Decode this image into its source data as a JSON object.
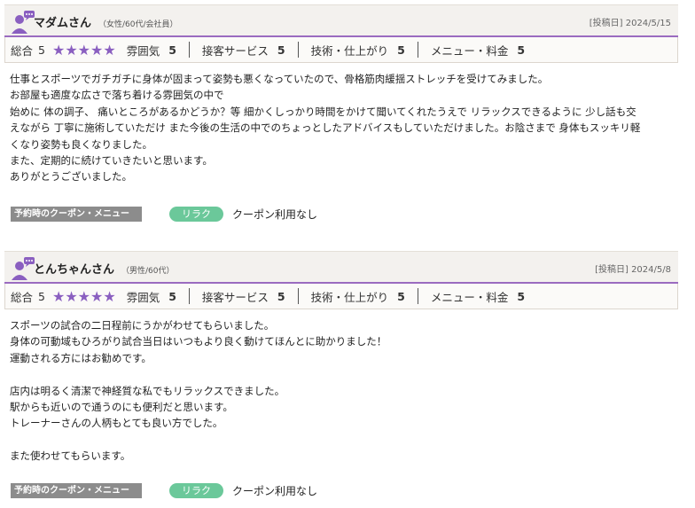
{
  "reviews": [
    {
      "name": "マダムさん",
      "meta": "（女性/60代/会社員）",
      "date": "[投稿日] 2024/5/15",
      "scores": {
        "total_label": "総合",
        "total": "5",
        "stars": "★★★★★",
        "items": [
          {
            "label": "雰囲気",
            "value": "5"
          },
          {
            "label": "接客サービス",
            "value": "5"
          },
          {
            "label": "技術・仕上がり",
            "value": "5"
          },
          {
            "label": "メニュー・料金",
            "value": "5"
          }
        ]
      },
      "body": [
        "仕事とスポーツでガチガチに身体が固まって姿勢も悪くなっていたので、骨格筋肉緩揺ストレッチを受けてみました。",
        "お部屋も適度な広さで落ち着ける雰囲気の中で",
        "始めに 体の調子、 痛いところがあるかどうか？等 細かくしっかり時間をかけて聞いてくれたうえで リラックスできるように 少し話も交",
        "えながら 丁寧に施術していただけ また今後の生活の中でのちょっとしたアドバイスもしていただけました。お陰さまで 身体もスッキリ軽",
        "くなり姿勢も良くなりました。",
        "また、定期的に続けていきたいと思います。",
        "ありがとうございました。"
      ],
      "coupon_label": "予約時のクーポン・メニュー",
      "tag": "リラク",
      "coupon_text": "クーポン利用なし"
    },
    {
      "name": "とんちゃんさん",
      "meta": "（男性/60代）",
      "date": "[投稿日] 2024/5/8",
      "scores": {
        "total_label": "総合",
        "total": "5",
        "stars": "★★★★★",
        "items": [
          {
            "label": "雰囲気",
            "value": "5"
          },
          {
            "label": "接客サービス",
            "value": "5"
          },
          {
            "label": "技術・仕上がり",
            "value": "5"
          },
          {
            "label": "メニュー・料金",
            "value": "5"
          }
        ]
      },
      "body": [
        "スポーツの試合の二日程前にうかがわせてもらいました。",
        "身体の可動域もひろがり試合当日はいつもより良く動けてほんとに助かりました！",
        "運動される方にはお勧めです。",
        "",
        "店内は明るく清潔で神経質な私でもリラックスできました。",
        "駅からも近いので通うのにも便利だと思います。",
        "トレーナーさんの人柄もとても良い方でした。",
        "",
        "また使わせてもらいます。"
      ],
      "coupon_label": "予約時のクーポン・メニュー",
      "tag": "リラク",
      "coupon_text": "クーポン利用なし"
    }
  ],
  "colors": {
    "accent": "#9a6bc0",
    "stars": "#8a5fc0",
    "tag": "#6bc89a",
    "coupon_label": "#8c8c8c"
  },
  "icons": {
    "avatar": "user-avatar-icon"
  }
}
